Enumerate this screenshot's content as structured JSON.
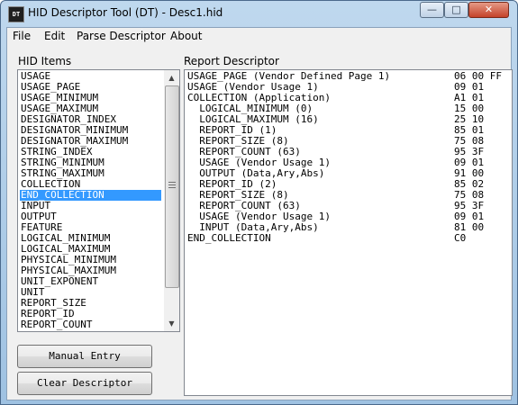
{
  "window": {
    "app_icon_text": "DT",
    "title": "HID Descriptor Tool (DT) - Desc1.hid",
    "minimize_symbol": "—",
    "maximize_symbol": "□",
    "close_symbol": "✕"
  },
  "menu": [
    "File",
    "Edit",
    "Parse Descriptor",
    "About"
  ],
  "hid_items": {
    "label": "HID Items",
    "selected": "END_COLLECTION",
    "items": [
      "USAGE",
      "USAGE_PAGE",
      "USAGE_MINIMUM",
      "USAGE_MAXIMUM",
      "DESIGNATOR_INDEX",
      "DESIGNATOR_MINIMUM",
      "DESIGNATOR_MAXIMUM",
      "STRING_INDEX",
      "STRING_MINIMUM",
      "STRING_MAXIMUM",
      "COLLECTION",
      "END_COLLECTION",
      "INPUT",
      "OUTPUT",
      "FEATURE",
      "LOGICAL_MINIMUM",
      "LOGICAL_MAXIMUM",
      "PHYSICAL_MINIMUM",
      "PHYSICAL_MAXIMUM",
      "UNIT_EXPONENT",
      "UNIT",
      "REPORT_SIZE",
      "REPORT_ID",
      "REPORT_COUNT"
    ]
  },
  "report_descriptor": {
    "label": "Report Descriptor",
    "rows": [
      {
        "text": "USAGE_PAGE (Vendor Defined Page 1)",
        "bytes": "06 00 FF"
      },
      {
        "text": "USAGE (Vendor Usage 1)",
        "bytes": "09 01"
      },
      {
        "text": "COLLECTION (Application)",
        "bytes": "A1 01"
      },
      {
        "text": "  LOGICAL_MINIMUM (0)",
        "bytes": "15 00"
      },
      {
        "text": "  LOGICAL_MAXIMUM (16)",
        "bytes": "25 10"
      },
      {
        "text": "  REPORT_ID (1)",
        "bytes": "85 01"
      },
      {
        "text": "  REPORT_SIZE (8)",
        "bytes": "75 08"
      },
      {
        "text": "  REPORT_COUNT (63)",
        "bytes": "95 3F"
      },
      {
        "text": "  USAGE (Vendor Usage 1)",
        "bytes": "09 01"
      },
      {
        "text": "  OUTPUT (Data,Ary,Abs)",
        "bytes": "91 00"
      },
      {
        "text": "  REPORT_ID (2)",
        "bytes": "85 02"
      },
      {
        "text": "  REPORT_SIZE (8)",
        "bytes": "75 08"
      },
      {
        "text": "  REPORT_COUNT (63)",
        "bytes": "95 3F"
      },
      {
        "text": "  USAGE (Vendor Usage 1)",
        "bytes": "09 01"
      },
      {
        "text": "  INPUT (Data,Ary,Abs)",
        "bytes": "81 00"
      },
      {
        "text": "END_COLLECTION",
        "bytes": "C0"
      }
    ]
  },
  "buttons": {
    "manual_entry": "Manual Entry",
    "clear_descriptor": "Clear Descriptor"
  },
  "scrollbar": {
    "up_arrow": "▲",
    "down_arrow": "▼"
  }
}
